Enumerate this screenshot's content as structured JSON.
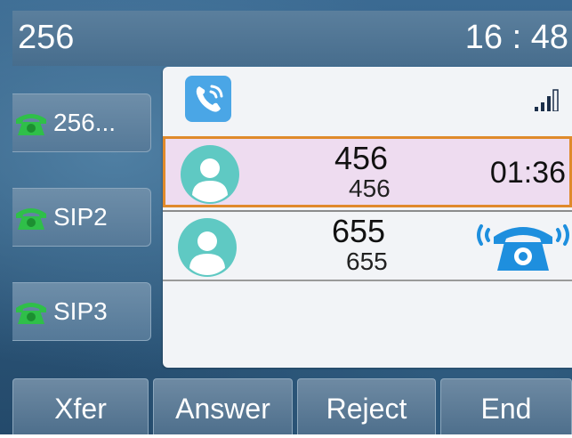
{
  "status_bar": {
    "account": "256",
    "time": "16 : 48"
  },
  "accounts": [
    {
      "label": "256..."
    },
    {
      "label": "SIP2"
    },
    {
      "label": "SIP3"
    }
  ],
  "calls": [
    {
      "name": "456",
      "number": "456",
      "duration": "01:36",
      "state": "talking"
    },
    {
      "name": "655",
      "number": "655",
      "state": "ringing"
    }
  ],
  "softkeys": [
    "Xfer",
    "Answer",
    "Reject",
    "End"
  ],
  "icons": {
    "account_phone": "phone-icon",
    "app": "call-app-icon",
    "signal": "signal-icon",
    "avatar": "contact-avatar-icon",
    "incoming": "incoming-call-icon"
  },
  "colors": {
    "selected_row": "#eedcf0",
    "selected_border": "#e08a2b",
    "phone_green": "#2fbf49",
    "ring_blue": "#1e8fde",
    "avatar_teal": "#5fc9c3"
  }
}
